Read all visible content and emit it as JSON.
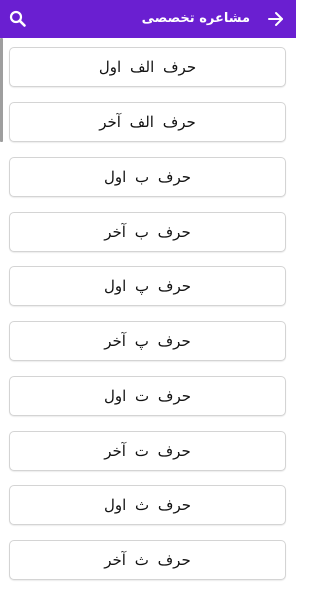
{
  "app_bar": {
    "title": "مشاعره تخصصی",
    "back_icon": "arrow-forward-icon",
    "search_icon": "search-icon",
    "background": "#6a1fd1"
  },
  "list": {
    "items": [
      {
        "label": "حرف  الف  اول"
      },
      {
        "label": "حرف  الف  آخر"
      },
      {
        "label": "حرف  ب  اول"
      },
      {
        "label": "حرف  ب  آخر"
      },
      {
        "label": "حرف  پ  اول"
      },
      {
        "label": "حرف  پ  آخر"
      },
      {
        "label": "حرف  ت  اول"
      },
      {
        "label": "حرف  ت  آخر"
      },
      {
        "label": "حرف  ث  اول"
      },
      {
        "label": "حرف  ث  آخر"
      }
    ]
  }
}
